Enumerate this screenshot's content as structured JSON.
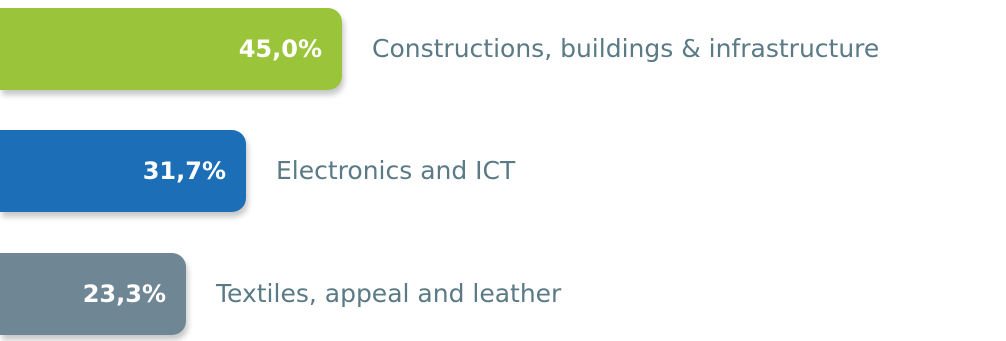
{
  "chart_data": {
    "type": "bar",
    "orientation": "horizontal",
    "categories": [
      "Constructions, buildings & infrastructure",
      "Electronics and ICT",
      "Textiles, appeal and leather"
    ],
    "values": [
      45.0,
      31.7,
      23.3
    ],
    "value_labels": [
      "45,0%",
      "31,7%",
      "23,3%"
    ],
    "colors": [
      "#9ac43a",
      "#1c6fb7",
      "#6f8794"
    ],
    "label_color": "#5a7a85",
    "grid": false,
    "legend": false
  }
}
